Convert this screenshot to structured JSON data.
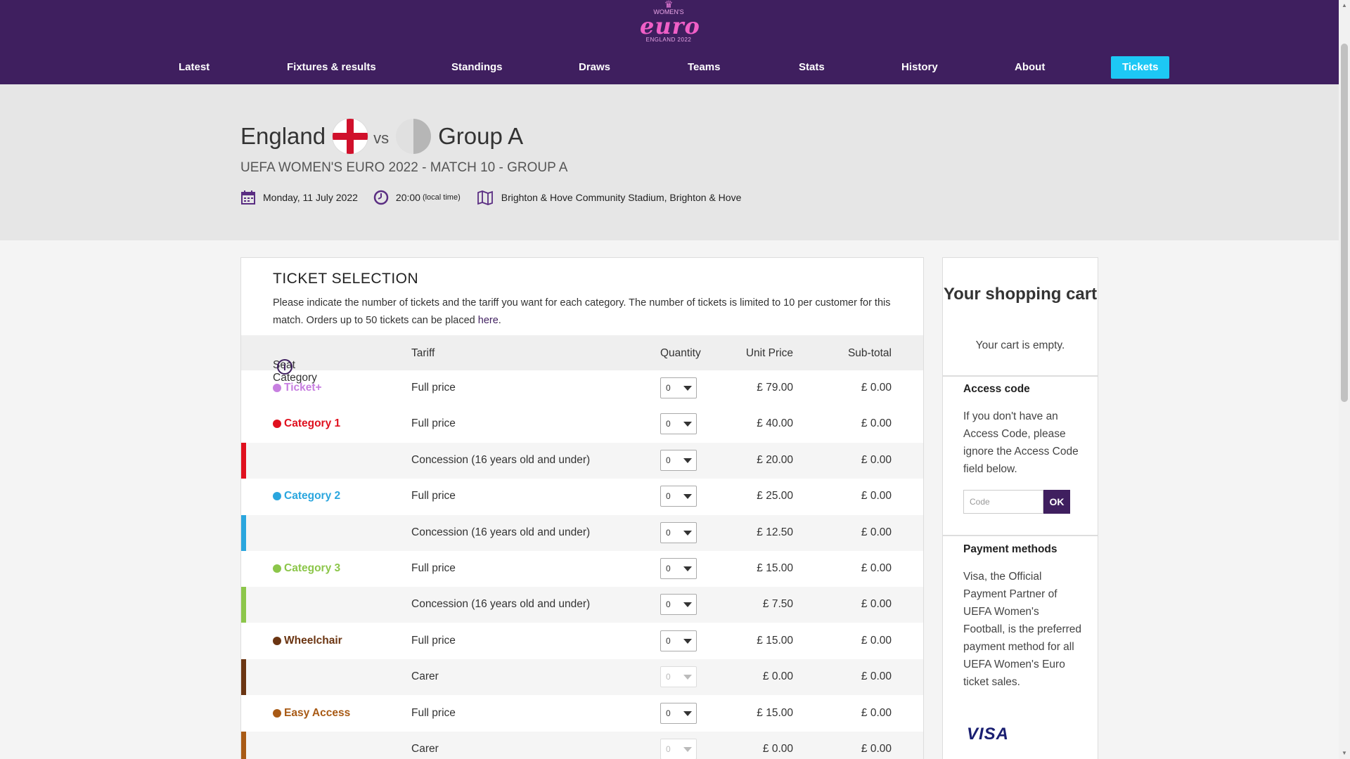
{
  "header": {
    "logo": {
      "top": "WOMEN'S",
      "word": "euro",
      "sub": "ENGLAND 2022"
    },
    "nav": [
      {
        "label": "Latest",
        "name": "nav-latest"
      },
      {
        "label": "Fixtures & results",
        "name": "nav-fixtures-results"
      },
      {
        "label": "Standings",
        "name": "nav-standings"
      },
      {
        "label": "Draws",
        "name": "nav-draws"
      },
      {
        "label": "Teams",
        "name": "nav-teams"
      },
      {
        "label": "Stats",
        "name": "nav-stats"
      },
      {
        "label": "History",
        "name": "nav-history"
      },
      {
        "label": "About",
        "name": "nav-about"
      },
      {
        "label": "Tickets",
        "name": "nav-tickets"
      }
    ],
    "tickets_color": "#1dc8f5",
    "background_color": "#3f1f5f"
  },
  "match": {
    "home": "England",
    "vs": "vs",
    "away": "Group A",
    "subtitle": "UEFA WOMEN'S EURO 2022  - MATCH 10 - GROUP A",
    "date": "Monday, 11 July 2022",
    "time": "20:00",
    "time_note": "(local time)",
    "venue": "Brighton & Hove Community Stadium, Brighton & Hove",
    "icons": [
      "calendar-icon",
      "clock-icon",
      "map-icon"
    ]
  },
  "tickets": {
    "title": "TICKET SELECTION",
    "intro_text": "Please indicate the number of tickets and the tariff you want for each category. The number of tickets is limited to 10 per customer for this match. Orders up to 50 tickets can be placed ",
    "intro_link": "here",
    "intro_end": ".",
    "columns": {
      "category": "Seat Category",
      "tariff": "Tariff",
      "quantity": "Quantity",
      "unit_price": "Unit Price",
      "subtotal": "Sub-total"
    },
    "rows": [
      {
        "category": "Ticket+",
        "color": "#c77fe0",
        "tariff": "Full price",
        "qty": "0",
        "price": "£ 79.00",
        "subtotal": "£ 0.00",
        "disabled": false
      },
      {
        "category": "Category 1",
        "color": "#e0101e",
        "tariff": "Full price",
        "qty": "0",
        "price": "£ 40.00",
        "subtotal": "£ 0.00",
        "disabled": false
      },
      {
        "category": "",
        "color": "#e0101e",
        "tariff": "Concession (16 years old and under)",
        "qty": "0",
        "price": "£ 20.00",
        "subtotal": "£ 0.00",
        "disabled": false
      },
      {
        "category": "Category 2",
        "color": "#2aa6de",
        "tariff": "Full price",
        "qty": "0",
        "price": "£ 25.00",
        "subtotal": "£ 0.00",
        "disabled": false
      },
      {
        "category": "",
        "color": "#2aa6de",
        "tariff": "Concession (16 years old and under)",
        "qty": "0",
        "price": "£ 12.50",
        "subtotal": "£ 0.00",
        "disabled": false
      },
      {
        "category": "Category 3",
        "color": "#8cc64a",
        "tariff": "Full price",
        "qty": "0",
        "price": "£ 15.00",
        "subtotal": "£ 0.00",
        "disabled": false
      },
      {
        "category": "",
        "color": "#8cc64a",
        "tariff": "Concession (16 years old and under)",
        "qty": "0",
        "price": "£ 7.50",
        "subtotal": "£ 0.00",
        "disabled": false
      },
      {
        "category": "Wheelchair",
        "color": "#6b3512",
        "tariff": "Full price",
        "qty": "0",
        "price": "£ 15.00",
        "subtotal": "£ 0.00",
        "disabled": false
      },
      {
        "category": "",
        "color": "#6b3512",
        "tariff": "Carer",
        "qty": "0",
        "price": "£ 0.00",
        "subtotal": "£ 0.00",
        "disabled": true
      },
      {
        "category": "Easy Access",
        "color": "#a85a15",
        "tariff": "Full price",
        "qty": "0",
        "price": "£ 15.00",
        "subtotal": "£ 0.00",
        "disabled": false
      },
      {
        "category": "",
        "color": "#a85a15",
        "tariff": "Carer",
        "qty": "0",
        "price": "£ 0.00",
        "subtotal": "£ 0.00",
        "disabled": true
      }
    ]
  },
  "cart": {
    "title": "Your shopping cart",
    "empty": "Your cart is empty.",
    "access_title": "Access code",
    "access_text": "If you don't have an Access Code, please ignore the Access Code field below.",
    "code_placeholder": "Code",
    "ok_label": "OK",
    "payment_title": "Payment methods",
    "payment_text": "Visa, the Official Payment Partner of UEFA Women's Football, is the preferred payment method for all UEFA Women's Euro ticket sales.",
    "visa": "VISA"
  }
}
